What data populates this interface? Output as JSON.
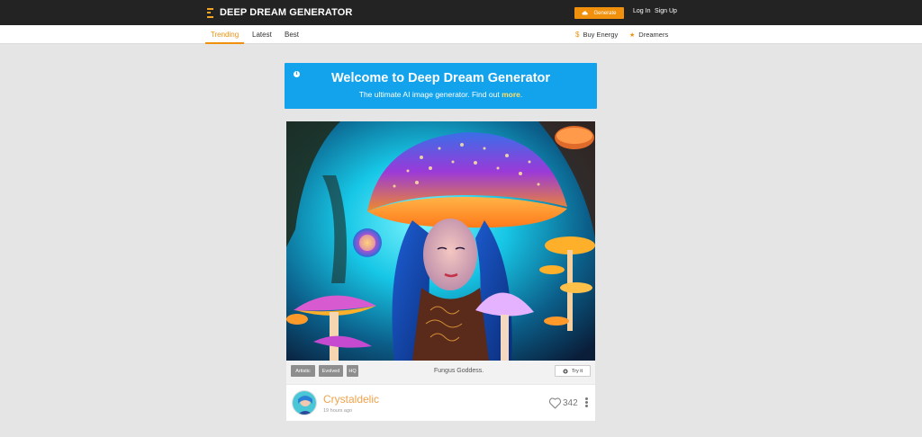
{
  "header": {
    "brand": "DEEP DREAM GENERATOR",
    "generate_label": "Generate",
    "login_label": "Log In",
    "signup_label": "Sign Up"
  },
  "nav": {
    "tabs": [
      {
        "label": "Trending",
        "active": true
      },
      {
        "label": "Latest",
        "active": false
      },
      {
        "label": "Best",
        "active": false
      }
    ],
    "buy_energy_label": "Buy Energy",
    "dreamers_label": "Dreamers"
  },
  "welcome": {
    "title": "Welcome to Deep Dream Generator",
    "subtitle": "The ultimate AI image generator. Find out",
    "more_link": "more",
    "period": "."
  },
  "post": {
    "tags": [
      "Artistic",
      "Evolved",
      "HQ"
    ],
    "caption": "Fungus Goddess.",
    "try_it_label": "Try it",
    "username": "Crystaldelic",
    "time": "19 hours ago",
    "likes": "342"
  },
  "colors": {
    "accent": "#f0900c",
    "welcome_bg": "#13a3ec",
    "topbar_bg": "#232323",
    "page_bg": "#e5e5e5"
  },
  "icons": {
    "logo": "ddg-logo-icon",
    "generate": "cloud-icon",
    "info": "info-icon",
    "buy": "dollar-icon",
    "dreamers": "star-icon",
    "try": "gear-icon",
    "like": "heart-icon",
    "menu": "more-vertical-icon"
  }
}
